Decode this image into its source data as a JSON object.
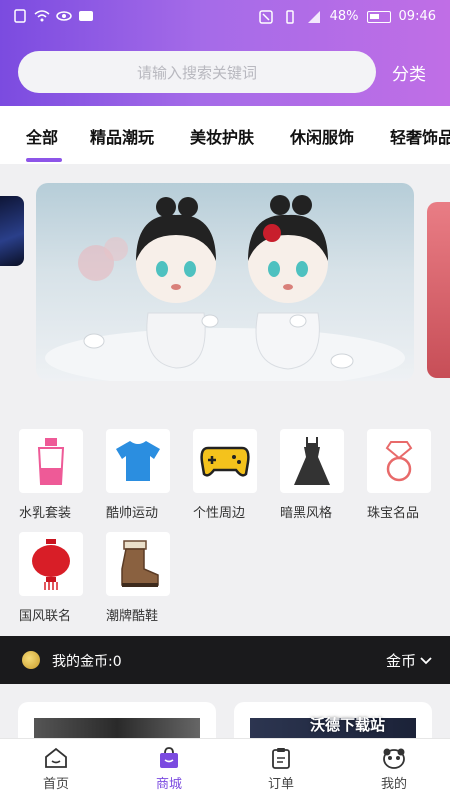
{
  "status_bar": {
    "time": "09:46",
    "battery": "48%"
  },
  "search": {
    "placeholder": "请输入搜索关键词",
    "category_label": "分类"
  },
  "tabs": [
    {
      "label": "全部",
      "active": true
    },
    {
      "label": "精品潮玩"
    },
    {
      "label": "美妆护肤"
    },
    {
      "label": "休闲服饰"
    },
    {
      "label": "轻奢饰品"
    }
  ],
  "grid": [
    {
      "label": "水乳套装",
      "icon": "cosmetic-tube-icon"
    },
    {
      "label": "酷帅运动",
      "icon": "tshirt-icon"
    },
    {
      "label": "个性周边",
      "icon": "gamepad-icon"
    },
    {
      "label": "暗黑风格",
      "icon": "dress-icon"
    },
    {
      "label": "珠宝名品",
      "icon": "ring-icon"
    },
    {
      "label": "国风联名",
      "icon": "lantern-icon"
    },
    {
      "label": "潮牌酷鞋",
      "icon": "boot-icon"
    }
  ],
  "coins": {
    "label": "我的金币:0",
    "selector": "金币"
  },
  "watermark": "沃德下载站",
  "bottom_nav": [
    {
      "label": "首页",
      "icon": "home-icon"
    },
    {
      "label": "商城",
      "icon": "shop-bag-icon",
      "active": true
    },
    {
      "label": "订单",
      "icon": "order-clipboard-icon"
    },
    {
      "label": "我的",
      "icon": "panda-face-icon"
    }
  ],
  "colors": {
    "accent": "#7b4be0",
    "header_start": "#7b4be0",
    "header_end": "#c06ee6"
  }
}
